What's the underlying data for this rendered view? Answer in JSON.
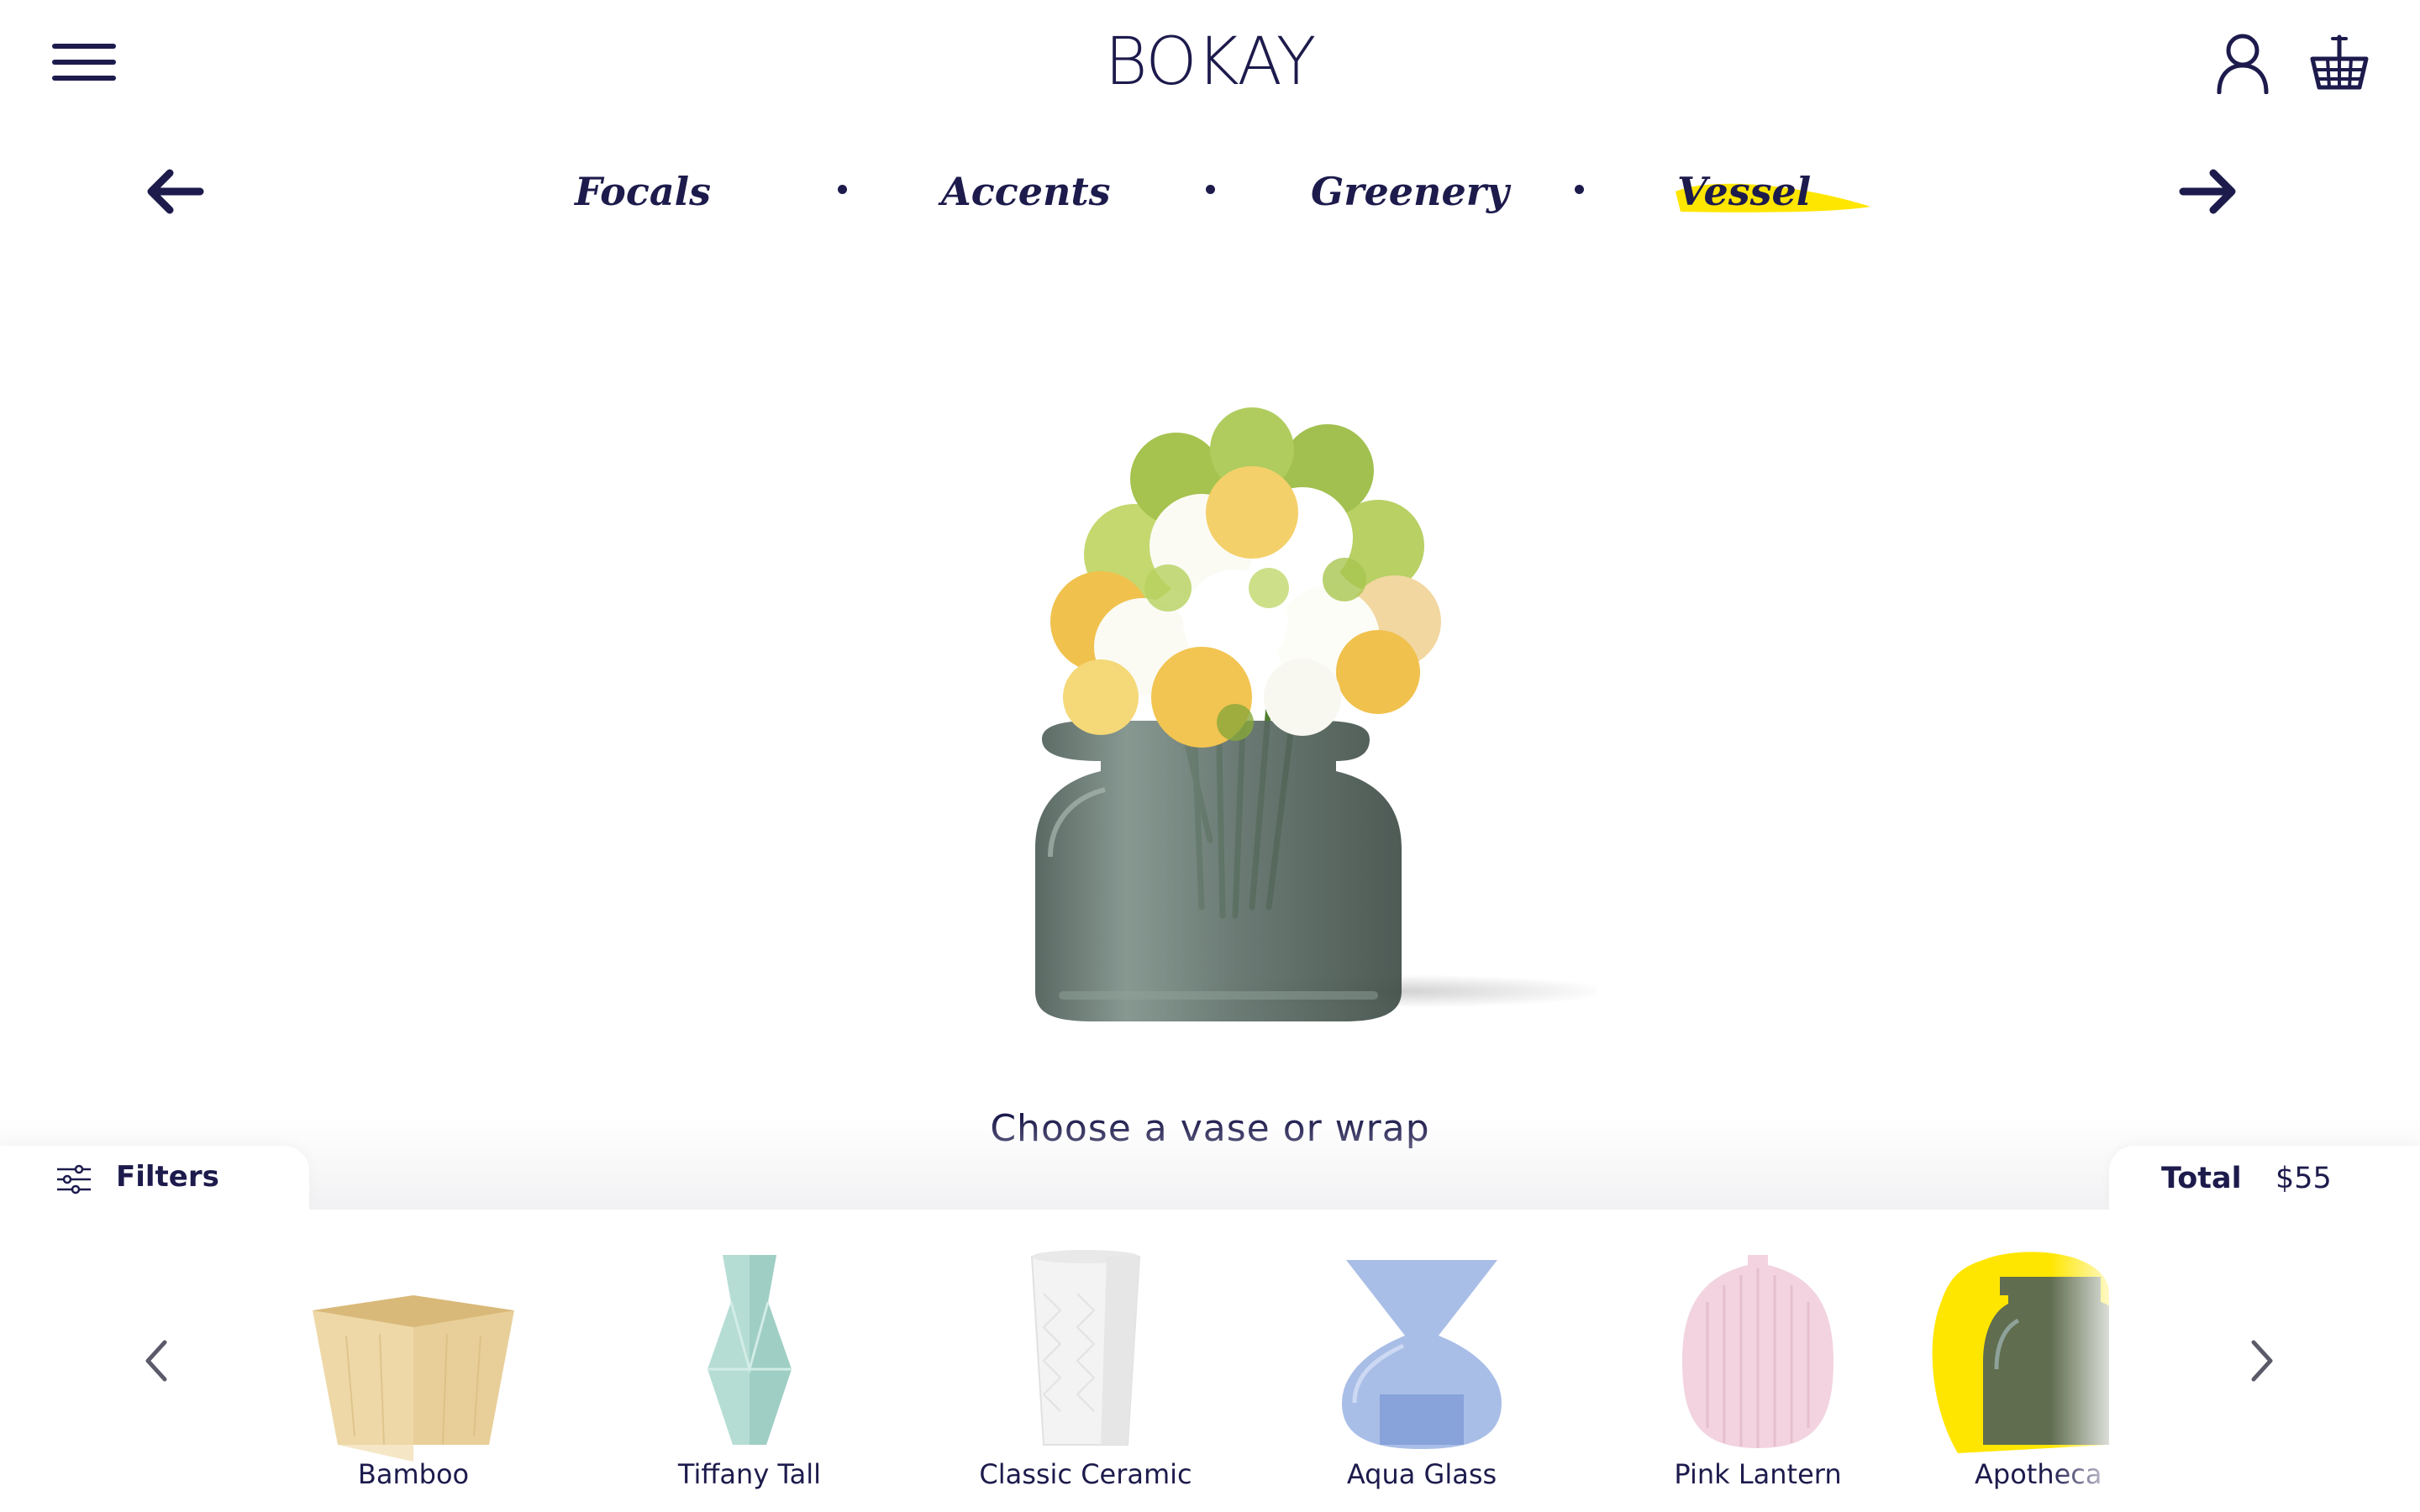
{
  "brand": {
    "logo": "BOKAY"
  },
  "steps": [
    {
      "label": "Focals"
    },
    {
      "label": "Accents"
    },
    {
      "label": "Greenery"
    },
    {
      "label": "Vessel"
    }
  ],
  "active_step": "Vessel",
  "prompt": "Choose a vase or wrap",
  "filters": {
    "label": "Filters"
  },
  "total": {
    "label": "Total",
    "value": "$55"
  },
  "vessels": [
    {
      "label": "Bamboo"
    },
    {
      "label": "Tiffany Tall"
    },
    {
      "label": "Classic Ceramic"
    },
    {
      "label": "Aqua Glass"
    },
    {
      "label": "Pink Lantern"
    },
    {
      "label": "Apotheca"
    }
  ],
  "colors": {
    "primary": "#1d1b4c",
    "highlight": "#ffe600",
    "background": "#ffffff"
  },
  "icons": {
    "menu": "hamburger-menu-icon",
    "account": "user-icon",
    "cart": "basket-icon",
    "prev": "arrow-left-icon",
    "next": "arrow-right-icon",
    "filters": "sliders-icon"
  }
}
